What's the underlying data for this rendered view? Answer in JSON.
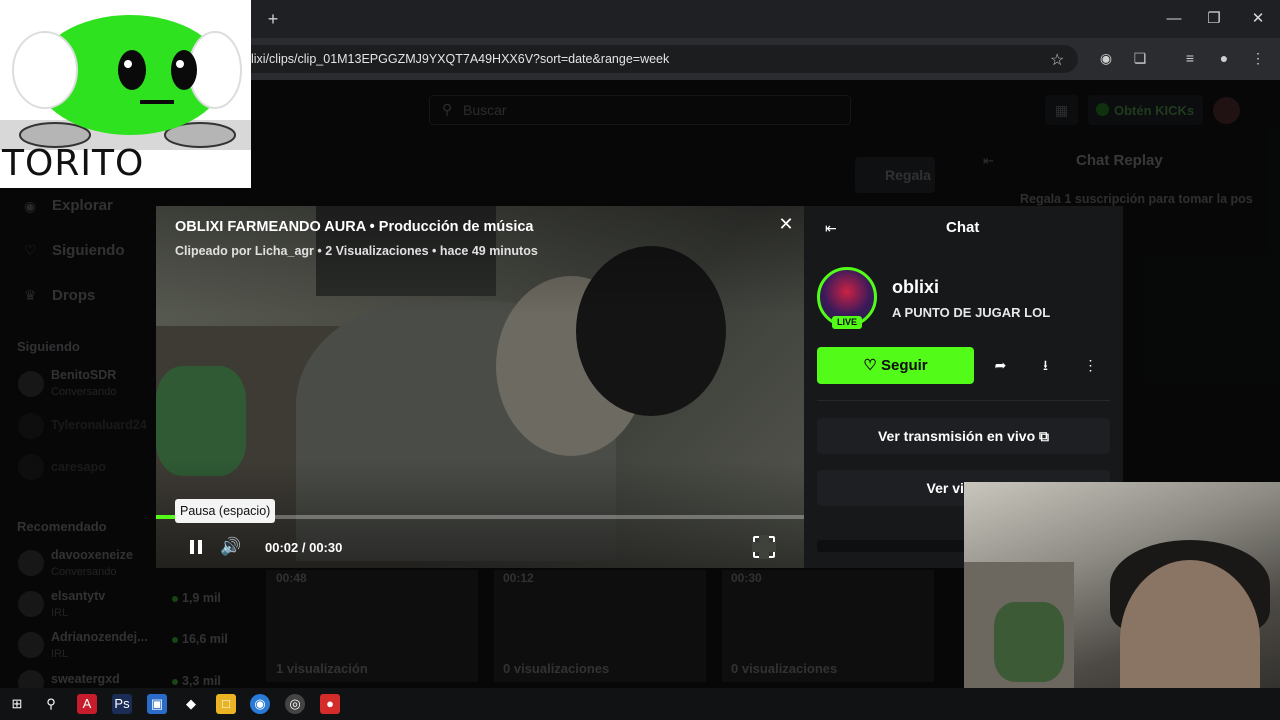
{
  "browser": {
    "url": "lixi/clips/clip_01M13EPGGZMJ9YXQT7A49HXX6V?sort=date&range=week",
    "new_tab": "+"
  },
  "overlay": {
    "logo_text": "TORITO"
  },
  "header": {
    "search_placeholder": "Buscar",
    "kicks_label": "Obtén KICKs"
  },
  "sidebar": {
    "nav": [
      {
        "label": "Explorar",
        "icon": "compass-icon"
      },
      {
        "label": "Siguiendo",
        "icon": "heart-icon"
      },
      {
        "label": "Drops",
        "icon": "crown-icon"
      }
    ],
    "following_heading": "Siguiendo",
    "following": [
      {
        "name": "BenitoSDR",
        "sub": "Conversando"
      },
      {
        "name": "Tyleronaluard24",
        "sub": ""
      },
      {
        "name": "caresapo",
        "sub": ""
      }
    ],
    "recommended_heading": "Recomendado",
    "recommended": [
      {
        "name": "davooxeneize",
        "sub": "Conversando",
        "viewers": ""
      },
      {
        "name": "elsantytv",
        "sub": "IRL",
        "viewers": "1,9 mil"
      },
      {
        "name": "Adrianozendej...",
        "sub": "IRL",
        "viewers": "16,6 mil"
      },
      {
        "name": "sweatergxd",
        "sub": "",
        "viewers": "3,3 mil"
      }
    ]
  },
  "background": {
    "gift_label": "Regala",
    "chat_replay_title": "Chat Replay",
    "replay_note": "Regala 1 suscripción para tomar la pos",
    "clips": [
      {
        "duration": "00:48",
        "views": "1 visualización"
      },
      {
        "duration": "00:12",
        "views": "0 visualizaciones"
      },
      {
        "duration": "00:30",
        "views": "0 visualizaciones"
      }
    ]
  },
  "clip": {
    "title": "OBLIXI FARMEANDO AURA • Producción de música",
    "meta": "Clipeado por Licha_agr • 2 Visualizaciones • hace 49 minutos",
    "tooltip": "Pausa (espacio)",
    "time": "00:02 / 00:30",
    "progress": 0.067
  },
  "chat": {
    "title": "Chat",
    "streamer": "oblixi",
    "status": "A PUNTO DE JUGAR LOL",
    "live": "LIVE",
    "follow_label": "Seguir",
    "watch_live": "Ver transmisión en vivo",
    "watch_video": "Ver video c"
  },
  "colors": {
    "accent": "#53fc18",
    "bg": "#0b0c0d",
    "panel": "#16181a"
  }
}
